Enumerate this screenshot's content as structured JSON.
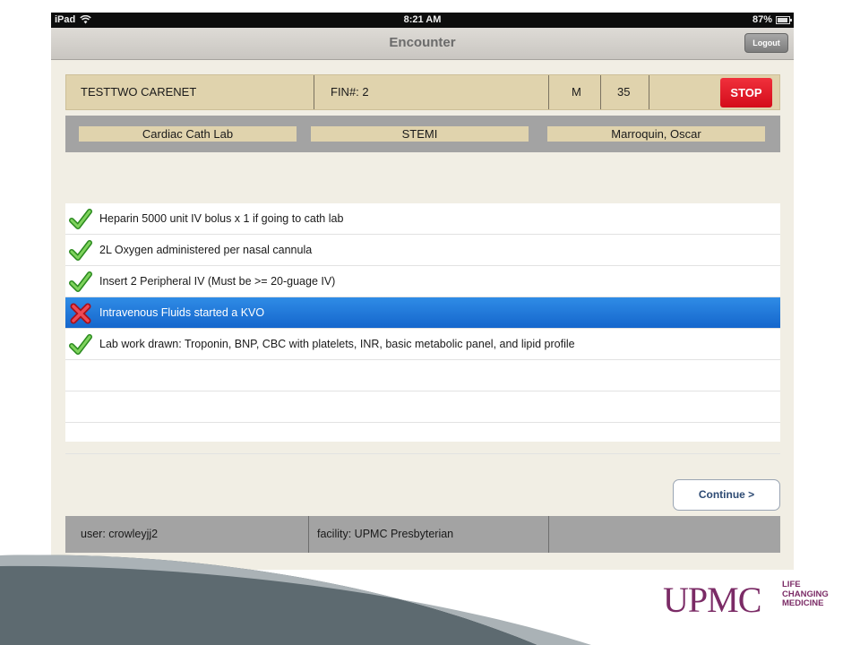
{
  "status_bar": {
    "device": "iPad",
    "time": "8:21 AM",
    "battery": "87%"
  },
  "nav": {
    "title": "Encounter",
    "logout_label": "Logout"
  },
  "patient": {
    "name": "TESTTWO CARENET",
    "fin": "FIN#:  2",
    "sex": "M",
    "age": "35",
    "stop_label": "STOP"
  },
  "context": {
    "location": "Cardiac Cath Lab",
    "protocol": "STEMI",
    "physician": "Marroquin, Oscar"
  },
  "tasks": [
    {
      "label": "Heparin 5000 unit IV bolus x 1 if going to cath lab",
      "status": "done",
      "icon": "check-icon"
    },
    {
      "label": "2L Oxygen administered per nasal cannula",
      "status": "done",
      "icon": "check-icon"
    },
    {
      "label": "Insert 2 Peripheral IV (Must be >= 20-guage IV)",
      "status": "done",
      "icon": "check-icon"
    },
    {
      "label": "Intravenous Fluids started a KVO",
      "status": "not-done",
      "icon": "x-icon",
      "selected": true
    },
    {
      "label": "Lab work drawn: Troponin, BNP, CBC with platelets, INR, basic metabolic panel, and lipid profile",
      "status": "done",
      "icon": "check-icon"
    },
    {
      "label": "",
      "status": "empty"
    },
    {
      "label": "",
      "status": "empty"
    },
    {
      "label": "",
      "status": "empty"
    }
  ],
  "continue_label": "Continue  >",
  "footer": {
    "user": "user: crowleyjj2",
    "facility": "facility: UPMC Presbyterian",
    "extra": ""
  },
  "branding": {
    "logo_text": "UPMC",
    "tagline_1": "LIFE",
    "tagline_2": "CHANGING",
    "tagline_3": "MEDICINE"
  },
  "colors": {
    "accent_selected": "#1a6fd4",
    "stop": "#e11f2b",
    "header_tan": "#e0d3ad",
    "brand_purple": "#7b2b66"
  }
}
